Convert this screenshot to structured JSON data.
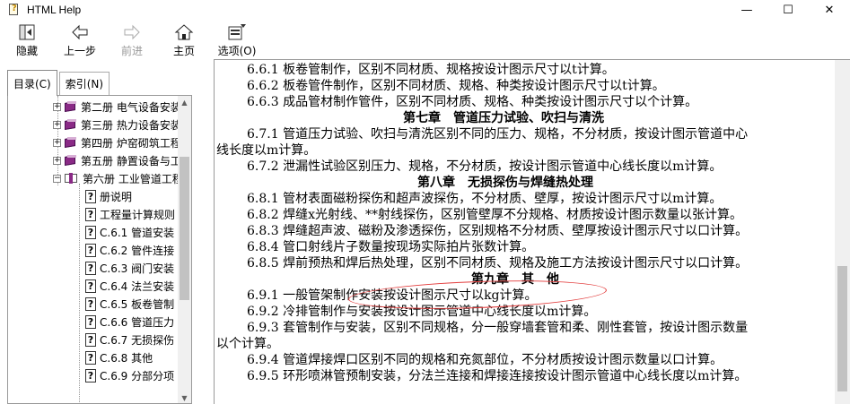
{
  "window": {
    "title": "HTML Help",
    "controls": [
      "—",
      "☐",
      "✕"
    ]
  },
  "toolbar": {
    "hide": "隐藏",
    "back": "上一步",
    "forward": "前进",
    "home": "主页",
    "options": "选项(O)"
  },
  "tabs": {
    "contents": "目录(C)",
    "index": "索引(N)"
  },
  "tree": {
    "books": [
      "第二册 电气设备安装",
      "第三册 热力设备安装",
      "第四册 炉窑砌筑工程",
      "第五册 静置设备与工",
      "第六册 工业管道工程"
    ],
    "pages": [
      "册说明",
      "工程量计算规则",
      "C.6.1 管道安装",
      "C.6.2 管件连接",
      "C.6.3 阀门安装",
      "C.6.4 法兰安装",
      "C.6.5 板卷管制",
      "C.6.6 管道压力",
      "C.6.7 无损探伤",
      "C.6.8 其他",
      "C.6.9 分部分项"
    ]
  },
  "content": {
    "lines": [
      "6.6.1  板卷管制作，区别不同材质、规格按设计图示尺寸以t计算。",
      "6.6.2  板卷管件制作，区别不同材质、规格、种类按设计图示尺寸以t计算。",
      "6.6.3  成品管材制作管件，区别不同材质、规格、种类按设计图示尺寸以个计算。",
      "第七章　管道压力试验、吹扫与清洗",
      "6.7.1  管道压力试验、吹扫与清洗区别不同的压力、规格，不分材质，按设计图示管道中心",
      "线长度以m计算。",
      "6.7.2  泄漏性试验区别压力、规格，不分材质，按设计图示管道中心线长度以m计算。",
      "第八章　无损探伤与焊缝热处理",
      "6.8.1  管材表面磁粉探伤和超声波探伤，不分材质、壁厚，按设计图示尺寸以m计算。",
      "6.8.2  焊缝x光射线、**射线探伤，区别管壁厚不分规格、材质按设计图示数量以张计算。",
      "6.8.3  焊缝超声波、磁粉及渗透探伤，区别规格不分材质、壁厚按设计图示尺寸以口计算。",
      "6.8.4  管口射线片子数量按现场实际拍片张数计算。",
      "6.8.5  焊前预热和焊后热处理，区别不同材质、规格及施工方法按设计图示尺寸以口计算。",
      "第九章　其　他",
      "6.9.1  一般管架制作安装按设计图示尺寸以kg计算。",
      "6.9.2  冷排管制作与安装按设计图示管道中心线长度以m计算。",
      "6.9.3  套管制作与安装，区别不同规格，分一般穿墙套管和柔、刚性套管，按设计图示数量",
      "以个计算。",
      "6.9.4  管道焊接焊口区别不同的规格和充氮部位，不分材质按设计图示数量以口计算。",
      "6.9.5  环形喷淋管预制安装，分法兰连接和焊接连接按设计图示管道中心线长度以m计算。"
    ]
  }
}
